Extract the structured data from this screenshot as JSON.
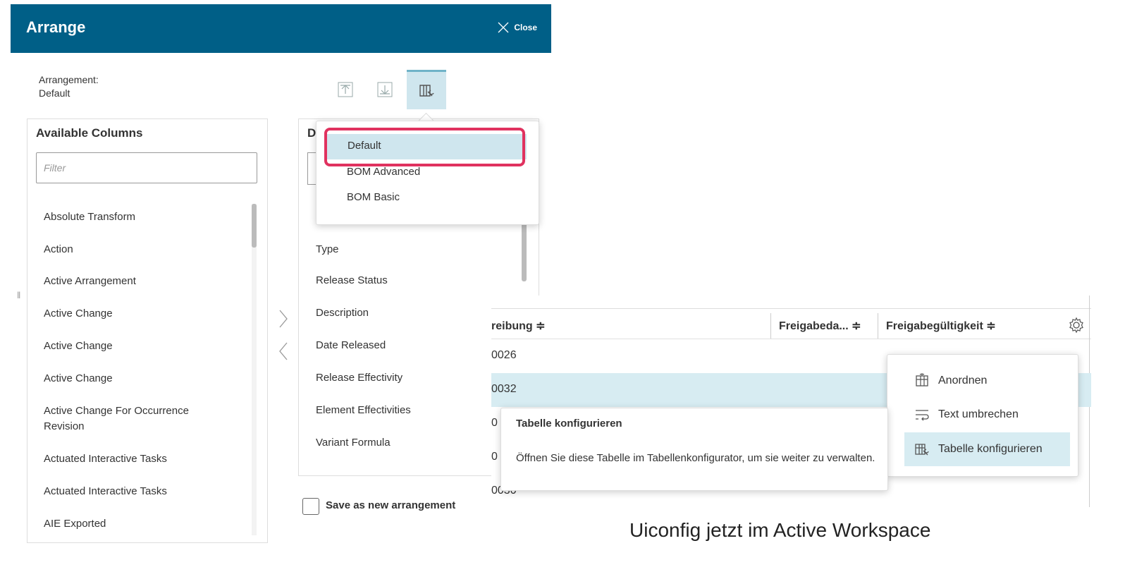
{
  "arrange": {
    "title": "Arrange",
    "close_label": "Close",
    "arrangement_label": "Arrangement:",
    "arrangement_value": "Default",
    "available_title": "Available Columns",
    "filter_placeholder": "Filter",
    "available_columns": [
      "Absolute Transform",
      "Action",
      "Active Arrangement",
      "Active Change",
      "Active Change",
      "Active Change",
      "Active Change For Occurrence\nRevision",
      "Actuated Interactive Tasks",
      "Actuated Interactive Tasks",
      "AIE Exported"
    ],
    "displayed_title_initial": "D",
    "displayed_columns": [
      "Type",
      "Release Status",
      "Description",
      "Date Released",
      "Release Effectivity",
      "Element Effectivities",
      "Variant Formula"
    ],
    "save_new_label": "Save as new arrangement",
    "dropdown_options": [
      "Default",
      "BOM Advanced",
      "BOM Basic"
    ],
    "highlight_color": "#e0325f",
    "header_color": "#005f87"
  },
  "workspace": {
    "headers": [
      "reibung ≑",
      "Freigabeda... ≑",
      "Freigabegültigkeit ≑"
    ],
    "rows": [
      "0026",
      "0032",
      "0",
      "0",
      "0030"
    ],
    "context_menu": [
      "Anordnen",
      "Text umbrechen",
      "Tabelle konfigurieren"
    ],
    "tooltip_title": "Tabelle konfigurieren",
    "tooltip_body": "Öffnen Sie diese Tabelle im Tabellenkonfigurator, um sie weiter zu verwalten."
  },
  "caption": "Uiconfig jetzt im Active Workspace"
}
